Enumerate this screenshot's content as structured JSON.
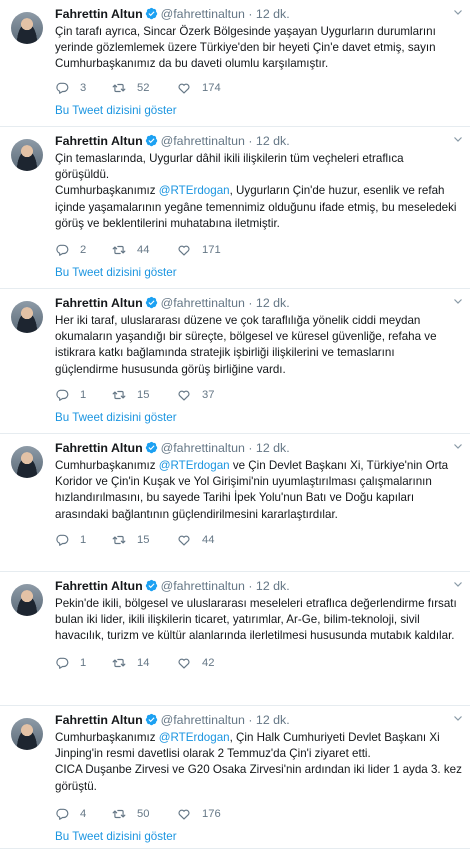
{
  "author": {
    "name": "Fahrettin Altun",
    "handle": "@fahrettinaltun",
    "separator": "·",
    "time": "12 dk."
  },
  "thread_link_label": "Bu Tweet dizisini göster",
  "tweets": [
    {
      "lines": [
        [
          {
            "t": "Çin tarafı ayrıca, Sincar Özerk Bölgesinde yaşayan Uygurların durumlarını"
          }
        ],
        [
          {
            "t": "yerinde gözlemlemek üzere Türkiye'den bir heyeti Çin'e davet etmiş, sayın"
          }
        ],
        [
          {
            "t": "Cumhurbaşkanımız da bu daveti olumlu karşılamıştır."
          }
        ]
      ],
      "replies": "3",
      "retweets": "52",
      "likes": "174",
      "show_thread": true
    },
    {
      "lines": [
        [
          {
            "t": "Çin temaslarında, Uygurlar dâhil ikili ilişkilerin tüm veçheleri etraflıca"
          }
        ],
        [
          {
            "t": "görüşüldü."
          }
        ],
        [
          {
            "t": "Cumhurbaşkanımız "
          },
          {
            "t": "@RTErdogan",
            "m": true
          },
          {
            "t": ", Uygurların Çin'de huzur, esenlik ve refah"
          }
        ],
        [
          {
            "t": "içinde yaşamalarının yegâne temennimiz olduğunu ifade etmiş, bu meseledeki"
          }
        ],
        [
          {
            "t": "görüş ve beklentilerini muhatabına iletmiştir."
          }
        ]
      ],
      "replies": "2",
      "retweets": "44",
      "likes": "171",
      "show_thread": true
    },
    {
      "lines": [
        [
          {
            "t": "Her iki taraf, uluslararası düzene ve çok taraflılığa yönelik ciddi meydan"
          }
        ],
        [
          {
            "t": "okumaların yaşandığı bir süreçte, bölgesel ve küresel güvenliğe, refaha ve"
          }
        ],
        [
          {
            "t": "istikrara katkı bağlamında stratejik işbirliği ilişkilerini ve temaslarını"
          }
        ],
        [
          {
            "t": "güçlendirme hususunda görüş birliğine vardı."
          }
        ]
      ],
      "replies": "1",
      "retweets": "15",
      "likes": "37",
      "show_thread": true
    },
    {
      "lines": [
        [
          {
            "t": "Cumhurbaşkanımız "
          },
          {
            "t": "@RTErdogan",
            "m": true
          },
          {
            "t": " ve Çin Devlet Başkanı Xi, Türkiye'nin Orta"
          }
        ],
        [
          {
            "t": "Koridor ve Çin'in Kuşak ve Yol Girişimi'nin uyumlaştırılması çalışmalarının"
          }
        ],
        [
          {
            "t": "hızlandırılmasını, bu sayede Tarihi İpek Yolu'nun Batı ve Doğu kapıları"
          }
        ],
        [
          {
            "t": "arasındaki bağlantının güçlendirilmesini kararlaştırdılar."
          }
        ]
      ],
      "replies": "1",
      "retweets": "15",
      "likes": "44",
      "show_thread": false
    },
    {
      "lines": [
        [
          {
            "t": "Pekin'de ikili, bölgesel ve uluslararası meseleleri etraflıca değerlendirme fırsatı"
          }
        ],
        [
          {
            "t": "bulan iki lider, ikili ilişkilerin ticaret, yatırımlar, Ar-Ge, bilim-teknoloji, sivil"
          }
        ],
        [
          {
            "t": "havacılık, turizm ve kültür alanlarında ilerletilmesi hususunda mutabık kaldılar."
          }
        ]
      ],
      "replies": "1",
      "retweets": "14",
      "likes": "42",
      "show_thread": false
    },
    {
      "lines": [
        [
          {
            "t": "Cumhurbaşkanımız "
          },
          {
            "t": "@RTErdogan",
            "m": true
          },
          {
            "t": ", Çin Halk Cumhuriyeti Devlet Başkanı Xi"
          }
        ],
        [
          {
            "t": "Jinping'in resmi davetlisi olarak 2 Temmuz'da Çin'i ziyaret etti."
          }
        ],
        [
          {
            "t": "CICA Duşanbe Zirvesi ve G20 Osaka Zirvesi'nin ardından iki lider 1 ayda 3. kez"
          }
        ],
        [
          {
            "t": "görüştü."
          }
        ]
      ],
      "replies": "4",
      "retweets": "50",
      "likes": "176",
      "show_thread": true
    }
  ]
}
